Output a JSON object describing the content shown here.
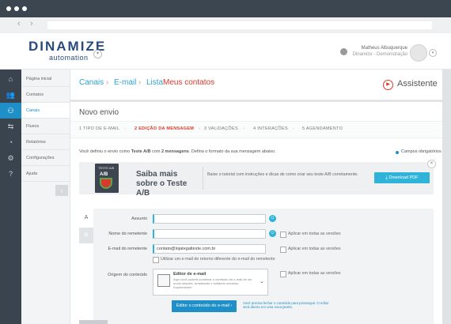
{
  "browser": {
    "back": "‹",
    "forward": "›"
  },
  "brand": {
    "name": "DINAMIZE",
    "sub": "automation",
    "dropdown": "▾"
  },
  "user": {
    "name": "Matheus Albuquerque",
    "org": "Dinamize - Demonstração",
    "dropdown": "▾"
  },
  "sidebar": {
    "items": [
      {
        "label": "Página inicial",
        "icon": "home-icon",
        "glyph": "⌂",
        "active": false
      },
      {
        "label": "Contatos",
        "icon": "users-icon",
        "glyph": "👥",
        "active": false
      },
      {
        "label": "Canais",
        "icon": "channels-icon",
        "glyph": "⚇",
        "active": true
      },
      {
        "label": "Fluxos",
        "icon": "flows-icon",
        "glyph": "⇆",
        "active": false
      },
      {
        "label": "Relatórios",
        "icon": "reports-icon",
        "glyph": "◔",
        "active": false
      },
      {
        "label": "Configurações",
        "icon": "settings-icon",
        "glyph": "⚙",
        "active": false
      },
      {
        "label": "Ajuda",
        "icon": "help-icon",
        "glyph": "?",
        "active": false
      }
    ],
    "collapse": "‹"
  },
  "breadcrumb": {
    "c1": "Canais",
    "c2": "E-mail",
    "c3": "Lista",
    "c4": "Meus contatos",
    "sep": "›",
    "dropdown": "⌄"
  },
  "assistant": {
    "label": "Assistente",
    "icon_glyph": "▶"
  },
  "page": {
    "title": "Novo envio"
  },
  "steps": [
    {
      "num": "1",
      "label": "TIPO DE E-MAIL",
      "active": false
    },
    {
      "num": "2",
      "label": "EDIÇÃO DA MENSAGEM",
      "active": true
    },
    {
      "num": "3",
      "label": "VALIDAÇÕES",
      "active": false
    },
    {
      "num": "4",
      "label": "INTERAÇÕES",
      "active": false
    },
    {
      "num": "5",
      "label": "AGENDAMENTO",
      "active": false
    }
  ],
  "intro": {
    "p1": "Você definiu o envio como ",
    "test": "Teste A/B",
    "p2": " com ",
    "msgs": "2 mensagens",
    "p3": ". Defina o formato da sua mensagem abaixo."
  },
  "required_note": "Campos obrigatórios",
  "promo": {
    "book_label": "TESTE A/B",
    "book_ab": "A/B",
    "title": "Saiba mais sobre o Teste A/B",
    "text": "Baixe o tutorial com instruções e dicas de como criar seu teste A/B corretamente.",
    "download": "Download PDF",
    "close": "×"
  },
  "tabs": {
    "a": "A",
    "b": "B"
  },
  "form": {
    "subject_label": "Assunto",
    "subject_value": "",
    "sender_name_label": "Nome do remetente",
    "sender_name_value": "",
    "sender_email_label": "E-mail do remetente",
    "sender_email_value": "contato@lojategalteste.com.br",
    "apply_all": "Aplicar em todas as versões",
    "reply_email": "Utilizar um e-mail de retorno diferente do e-mail do remetente",
    "origin_label": "Origem do conteúdo",
    "origin_title": "Editor de e-mail",
    "origin_desc": "Aqui você poderá combinar o conteúdo do e-mail de um modo simples. Arrastando e soltando módulos. Experimente!",
    "editor_button": "Editor o conteúdo do e-mail ›",
    "editor_note": "Você precisa fechar o conteúdo para prosseguir. O editor será aberto em uma nova janela."
  }
}
